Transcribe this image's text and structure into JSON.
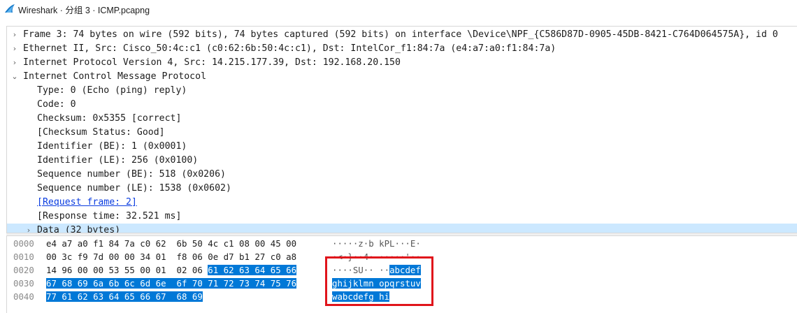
{
  "window": {
    "title": "Wireshark · 分组 3 · ICMP.pcapng",
    "accent": "#0078d7",
    "callout_color": "#e0141b"
  },
  "details": [
    {
      "indent": 0,
      "expander": "collapsed",
      "text": "Frame 3: 74 bytes on wire (592 bits), 74 bytes captured (592 bits) on interface \\Device\\NPF_{C586D87D-0905-45DB-8421-C764D064575A}, id 0"
    },
    {
      "indent": 0,
      "expander": "collapsed",
      "text": "Ethernet II, Src: Cisco_50:4c:c1 (c0:62:6b:50:4c:c1), Dst: IntelCor_f1:84:7a (e4:a7:a0:f1:84:7a)"
    },
    {
      "indent": 0,
      "expander": "collapsed",
      "text": "Internet Protocol Version 4, Src: 14.215.177.39, Dst: 192.168.20.150"
    },
    {
      "indent": 0,
      "expander": "expanded",
      "text": "Internet Control Message Protocol"
    },
    {
      "indent": 1,
      "expander": "none",
      "text": "Type: 0 (Echo (ping) reply)"
    },
    {
      "indent": 1,
      "expander": "none",
      "text": "Code: 0"
    },
    {
      "indent": 1,
      "expander": "none",
      "text": "Checksum: 0x5355 [correct]"
    },
    {
      "indent": 1,
      "expander": "none",
      "text": "[Checksum Status: Good]"
    },
    {
      "indent": 1,
      "expander": "none",
      "text": "Identifier (BE): 1 (0x0001)"
    },
    {
      "indent": 1,
      "expander": "none",
      "text": "Identifier (LE): 256 (0x0100)"
    },
    {
      "indent": 1,
      "expander": "none",
      "text": "Sequence number (BE): 518 (0x0206)"
    },
    {
      "indent": 1,
      "expander": "none",
      "text": "Sequence number (LE): 1538 (0x0602)"
    },
    {
      "indent": 1,
      "expander": "none",
      "link": true,
      "text": "[Request frame: 2]"
    },
    {
      "indent": 1,
      "expander": "none",
      "text": "[Response time: 32.521 ms]"
    },
    {
      "indent": 1,
      "expander": "collapsed",
      "selected": true,
      "text": "Data (32 bytes)"
    }
  ],
  "bytes": [
    {
      "offset": "0000",
      "hex": [
        {
          "text": "e4 a7 a0 f1 84 7a c0 62  6b 50 4c c1 08 00 45 00",
          "hl": false
        }
      ],
      "ascii": [
        {
          "text": "·····z·b kPL···E·",
          "hl": false
        }
      ]
    },
    {
      "offset": "0010",
      "hex": [
        {
          "text": "00 3c f9 7d 00 00 34 01  f8 06 0e d7 b1 27 c0 a8",
          "hl": false
        }
      ],
      "ascii": [
        {
          "text": "·<·}··4· ·····'··",
          "hl": false
        }
      ]
    },
    {
      "offset": "0020",
      "hex": [
        {
          "text": "14 96 00 00 53 55 00 01  02 06 ",
          "hl": false
        },
        {
          "text": "61 62 63 64 65 66",
          "hl": true
        }
      ],
      "ascii": [
        {
          "text": "····SU·· ··",
          "hl": false
        },
        {
          "text": "abcdef",
          "hl": true
        }
      ]
    },
    {
      "offset": "0030",
      "hex": [
        {
          "text": "67 68 69 6a 6b 6c 6d 6e  6f 70 71 72 73 74 75 76",
          "hl": true
        }
      ],
      "ascii": [
        {
          "text": "ghijklmn opqrstuv",
          "hl": true
        }
      ]
    },
    {
      "offset": "0040",
      "hex": [
        {
          "text": "77 61 62 63 64 65 66 67  68 69",
          "hl": true
        }
      ],
      "ascii": [
        {
          "text": "wabcdefg hi",
          "hl": true
        }
      ]
    }
  ]
}
